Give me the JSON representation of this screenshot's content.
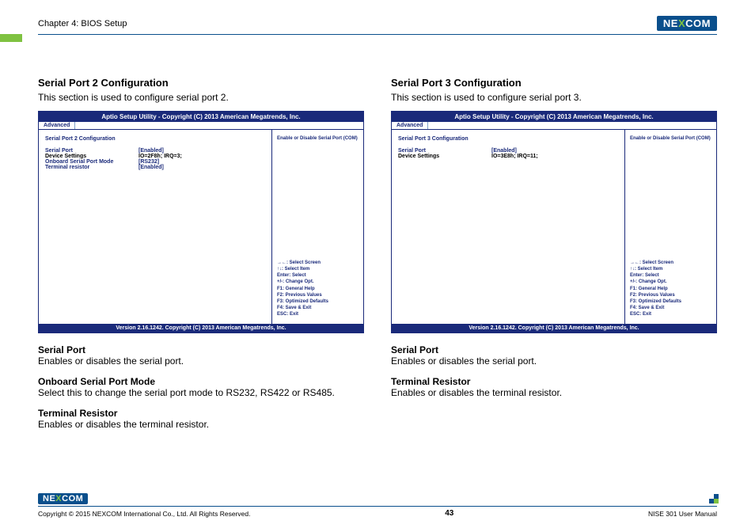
{
  "header": {
    "chapter": "Chapter 4: BIOS Setup",
    "logo_pre": "NE",
    "logo_x": "X",
    "logo_post": "COM"
  },
  "left": {
    "title": "Serial Port 2 Configuration",
    "desc": "This section is used to configure serial port 2.",
    "bios": {
      "titlebar": "Aptio Setup Utility - Copyright (C) 2013 American Megatrends, Inc.",
      "tab": "Advanced",
      "config_heading": "Serial Port 2 Configuration",
      "rows": [
        {
          "label": "Serial Port",
          "value": "[Enabled]",
          "labelColor": "blue",
          "valueColor": "blue"
        },
        {
          "label": "Device Settings",
          "value": "IO=2F8h; IRQ=3;",
          "labelColor": "black",
          "valueColor": "black"
        },
        {
          "label": "Onboard Serial Port Mode",
          "value": "[RS232]",
          "labelColor": "blue",
          "valueColor": "blue"
        },
        {
          "label": "Terminal resistor",
          "value": "[Enabled]",
          "labelColor": "blue",
          "valueColor": "blue"
        }
      ],
      "help_top": "Enable or Disable Serial Port (COM)",
      "help_keys": [
        "→←: Select Screen",
        "↑↓: Select Item",
        "Enter: Select",
        "+/-: Change Opt.",
        "F1: General Help",
        "F2: Previous Values",
        "F3: Optimized Defaults",
        "F4: Save & Exit",
        "ESC: Exit"
      ],
      "version": "Version 2.16.1242. Copyright (C) 2013 American Megatrends, Inc."
    },
    "descs": [
      {
        "t": "Serial Port",
        "d": "Enables or disables the serial port."
      },
      {
        "t": "Onboard Serial Port Mode",
        "d": "Select this to change the serial port mode to RS232, RS422 or RS485."
      },
      {
        "t": "Terminal Resistor",
        "d": "Enables or disables the terminal resistor."
      }
    ]
  },
  "right": {
    "title": "Serial Port 3 Configuration",
    "desc": "This section is used to configure serial port 3.",
    "bios": {
      "titlebar": "Aptio Setup Utility - Copyright (C) 2013 American Megatrends, Inc.",
      "tab": "Advanced",
      "config_heading": "Serial Port 3 Configuration",
      "rows": [
        {
          "label": "Serial Port",
          "value": "[Enabled]",
          "labelColor": "blue",
          "valueColor": "blue"
        },
        {
          "label": "Device Settings",
          "value": "IO=3E8h; IRQ=11;",
          "labelColor": "black",
          "valueColor": "black"
        }
      ],
      "help_top": "Enable or Disable Serial Port (COM)",
      "help_keys": [
        "→←: Select Screen",
        "↑↓: Select Item",
        "Enter: Select",
        "+/-: Change Opt.",
        "F1: General Help",
        "F2: Previous Values",
        "F3: Optimized Defaults",
        "F4: Save & Exit",
        "ESC: Exit"
      ],
      "version": "Version 2.16.1242. Copyright (C) 2013 American Megatrends, Inc."
    },
    "descs": [
      {
        "t": "Serial Port",
        "d": "Enables or disables the serial port."
      },
      {
        "t": "Terminal Resistor",
        "d": "Enables or disables the terminal resistor."
      }
    ]
  },
  "footer": {
    "copyright": "Copyright © 2015 NEXCOM International Co., Ltd. All Rights Reserved.",
    "page": "43",
    "manual": "NISE 301 User Manual"
  }
}
